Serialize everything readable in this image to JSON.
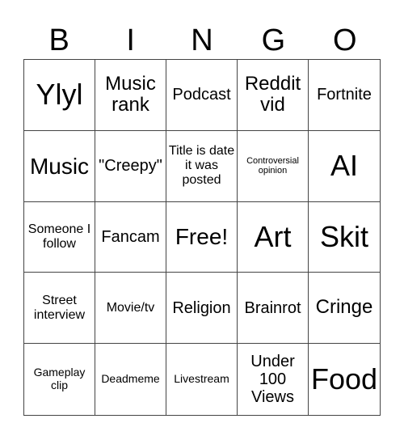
{
  "header": [
    "B",
    "I",
    "N",
    "G",
    "O"
  ],
  "cells": [
    {
      "text": "Ylyl",
      "size": "s-xl"
    },
    {
      "text": "Music rank",
      "size": "s-md"
    },
    {
      "text": "Podcast",
      "size": "s-sm"
    },
    {
      "text": "Reddit vid",
      "size": "s-md"
    },
    {
      "text": "Fortnite",
      "size": "s-sm"
    },
    {
      "text": "Music",
      "size": "s-lg"
    },
    {
      "text": "\"Creepy\"",
      "size": "s-sm"
    },
    {
      "text": "Title is date it was posted",
      "size": "s-xs"
    },
    {
      "text": "Controversial opinion",
      "size": "s-tiny"
    },
    {
      "text": "AI",
      "size": "s-xl"
    },
    {
      "text": "Someone I follow",
      "size": "s-xs"
    },
    {
      "text": "Fancam",
      "size": "s-sm"
    },
    {
      "text": "Free!",
      "size": "s-lg"
    },
    {
      "text": "Art",
      "size": "s-xl"
    },
    {
      "text": "Skit",
      "size": "s-xl"
    },
    {
      "text": "Street interview",
      "size": "s-xs"
    },
    {
      "text": "Movie/tv",
      "size": "s-xs"
    },
    {
      "text": "Religion",
      "size": "s-sm"
    },
    {
      "text": "Brainrot",
      "size": "s-sm"
    },
    {
      "text": "Cringe",
      "size": "s-md"
    },
    {
      "text": "Gameplay clip",
      "size": "s-xxs"
    },
    {
      "text": "Deadmeme",
      "size": "s-xxs"
    },
    {
      "text": "Livestream",
      "size": "s-xxs"
    },
    {
      "text": "Under 100 Views",
      "size": "s-sm"
    },
    {
      "text": "Food",
      "size": "s-xl"
    }
  ]
}
